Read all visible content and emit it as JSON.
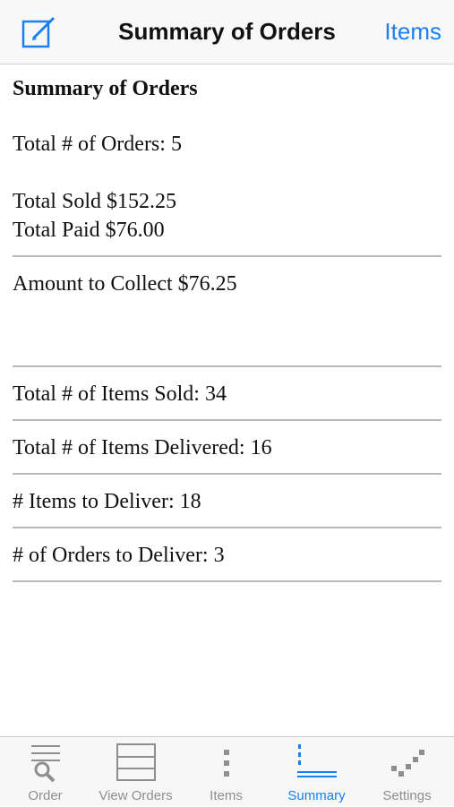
{
  "navbar": {
    "title": "Summary of Orders",
    "right_button": "Items",
    "left_icon": "compose-icon"
  },
  "summary": {
    "heading": "Summary of Orders",
    "total_orders": "Total # of Orders: 5",
    "total_sold": "Total Sold $152.25",
    "total_paid": "Total Paid $76.00",
    "amount_to_collect": "Amount to Collect $76.25",
    "items_sold": "Total # of Items Sold: 34",
    "items_delivered": "Total # of Items Delivered: 16",
    "items_to_deliver": "# Items to Deliver: 18",
    "orders_to_deliver": "# of Orders to Deliver: 3"
  },
  "tabs": [
    {
      "label": "Order",
      "icon": "order-icon"
    },
    {
      "label": "View Orders",
      "icon": "view-orders-icon"
    },
    {
      "label": "Items",
      "icon": "items-icon"
    },
    {
      "label": "Summary",
      "icon": "summary-icon",
      "active": true
    },
    {
      "label": "Settings",
      "icon": "settings-icon"
    }
  ],
  "colors": {
    "accent": "#1a7ff0",
    "inactive_tab": "#8e8e8e",
    "divider": "#b8b8b8"
  }
}
